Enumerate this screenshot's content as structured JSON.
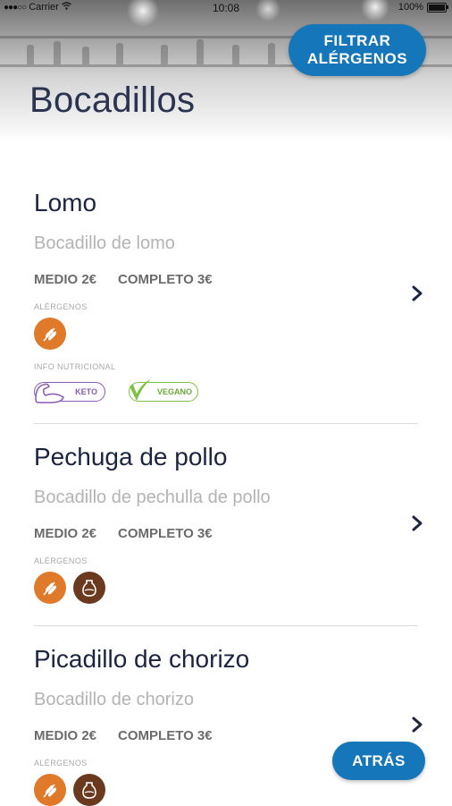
{
  "status_bar": {
    "carrier": "Carrier",
    "time": "10:08",
    "battery": "100%"
  },
  "header": {
    "title": "Bocadillos",
    "filter_line1": "FILTRAR",
    "filter_line2": "ALÉRGENOS"
  },
  "labels": {
    "allergens": "ALÉRGENOS",
    "nutrition": "INFO NUTRICIONAL"
  },
  "items": [
    {
      "name": "Lomo",
      "description": "Bocadillo de lomo",
      "price_medio": "MEDIO 2€",
      "price_completo": "COMPLETO 3€",
      "allergens": [
        "gluten-icon"
      ],
      "nutrition": [
        {
          "icon": "keto-arm-icon",
          "label": "KETO",
          "color": "#8a5bb5"
        },
        {
          "icon": "vegan-leaf-icon",
          "label": "VEGANO",
          "color": "#7cc142"
        }
      ]
    },
    {
      "name": "Pechuga de pollo",
      "description": "Bocadillo de pechulla de pollo",
      "price_medio": "MEDIO 2€",
      "price_completo": "COMPLETO 3€",
      "allergens": [
        "gluten-icon",
        "milk-icon"
      ]
    },
    {
      "name": "Picadillo de chorizo",
      "description": "Bocadillo de chorizo",
      "price_medio": "MEDIO 2€",
      "price_completo": "COMPLETO 3€",
      "allergens": [
        "gluten-icon",
        "milk-icon"
      ]
    }
  ],
  "footer": {
    "back_label": "ATRÁS"
  },
  "colors": {
    "accent": "#1577b9",
    "gluten": "#e07a2b",
    "milk": "#6b3a1e"
  }
}
